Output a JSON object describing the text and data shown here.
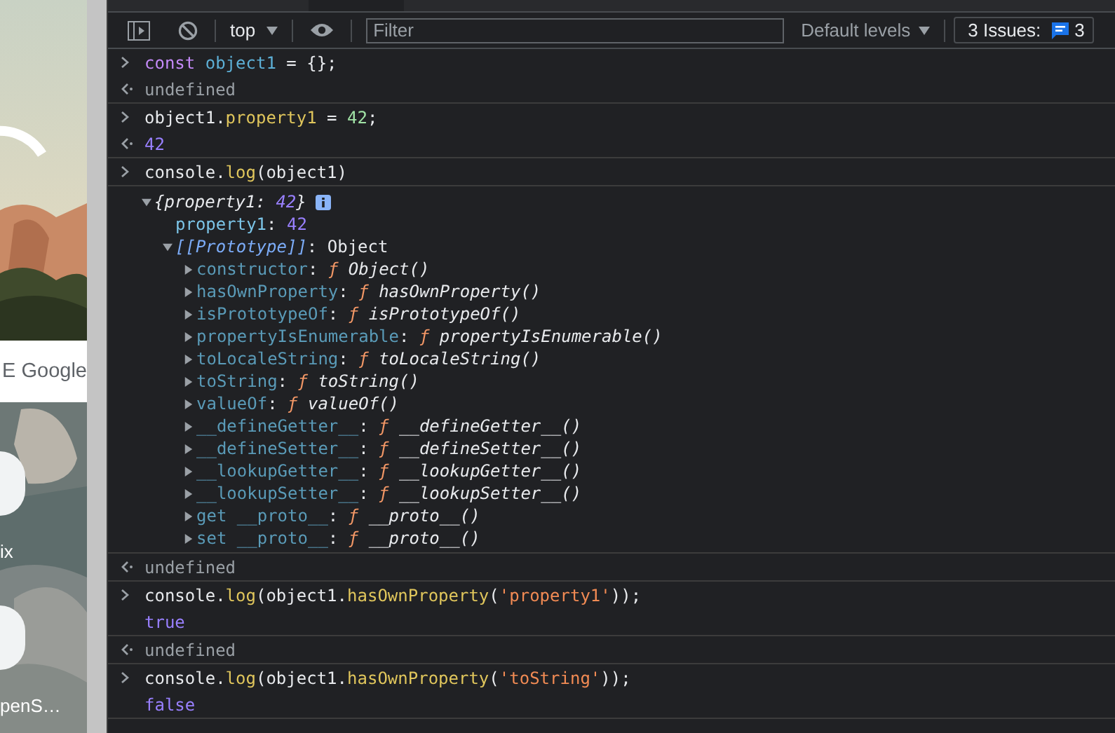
{
  "browser_page": {
    "search_label": "E Google",
    "shortcuts": [
      {
        "label": "ix"
      },
      {
        "label": "penS…"
      }
    ]
  },
  "toolbar": {
    "context": "top",
    "filter": {
      "placeholder": "Filter"
    },
    "levels": "Default levels",
    "issues": {
      "label": "3 Issues:",
      "count": "3"
    }
  },
  "console": [
    {
      "messages": [
        {
          "kind": "input",
          "tokens": [
            {
              "t": "const ",
              "kind": "kw"
            },
            {
              "t": "object1",
              "kind": "var"
            },
            {
              "t": " = {};",
              "kind": "plain"
            }
          ]
        },
        {
          "kind": "result",
          "tokens": [
            {
              "t": "undefined",
              "kind": "dim"
            }
          ]
        }
      ]
    },
    {
      "messages": [
        {
          "kind": "input",
          "tokens": [
            {
              "t": "object1.",
              "kind": "plain"
            },
            {
              "t": "property1",
              "kind": "prop"
            },
            {
              "t": " = ",
              "kind": "plain"
            },
            {
              "t": "42",
              "kind": "num"
            },
            {
              "t": ";",
              "kind": "plain"
            }
          ]
        },
        {
          "kind": "result",
          "tokens": [
            {
              "t": "42",
              "kind": "num2"
            }
          ]
        }
      ]
    },
    {
      "messages": [
        {
          "kind": "input",
          "tokens": [
            {
              "t": "console.",
              "kind": "plain"
            },
            {
              "t": "log",
              "kind": "prop"
            },
            {
              "t": "(object1)",
              "kind": "plain"
            }
          ]
        }
      ]
    },
    {
      "messages": [
        {
          "kind": "tree",
          "node": {
            "expanded": true,
            "info_icon": true,
            "tokens": [
              {
                "t": "{property1: ",
                "kind": "summary"
              },
              {
                "t": "42",
                "kind": "summary-num"
              },
              {
                "t": "}",
                "kind": "summary"
              }
            ],
            "children": [
              {
                "tokens": [
                  {
                    "t": "property1",
                    "kind": "key"
                  },
                  {
                    "t": ": ",
                    "kind": "plain"
                  },
                  {
                    "t": "42",
                    "kind": "num2"
                  }
                ]
              },
              {
                "expanded": true,
                "tokens": [
                  {
                    "t": "[[Prototype]]",
                    "kind": "proto-label"
                  },
                  {
                    "t": ": Object",
                    "kind": "plain"
                  }
                ],
                "children": [
                  {
                    "expanded": false,
                    "tokens": [
                      {
                        "t": "constructor",
                        "kind": "key-proto"
                      },
                      {
                        "t": ": ",
                        "kind": "plain"
                      },
                      {
                        "t": "ƒ ",
                        "kind": "fn-mark"
                      },
                      {
                        "t": "Object()",
                        "kind": "fn-name"
                      }
                    ]
                  },
                  {
                    "expanded": false,
                    "tokens": [
                      {
                        "t": "hasOwnProperty",
                        "kind": "key-proto"
                      },
                      {
                        "t": ": ",
                        "kind": "plain"
                      },
                      {
                        "t": "ƒ ",
                        "kind": "fn-mark"
                      },
                      {
                        "t": "hasOwnProperty()",
                        "kind": "fn-name"
                      }
                    ]
                  },
                  {
                    "expanded": false,
                    "tokens": [
                      {
                        "t": "isPrototypeOf",
                        "kind": "key-proto"
                      },
                      {
                        "t": ": ",
                        "kind": "plain"
                      },
                      {
                        "t": "ƒ ",
                        "kind": "fn-mark"
                      },
                      {
                        "t": "isPrototypeOf()",
                        "kind": "fn-name"
                      }
                    ]
                  },
                  {
                    "expanded": false,
                    "tokens": [
                      {
                        "t": "propertyIsEnumerable",
                        "kind": "key-proto"
                      },
                      {
                        "t": ": ",
                        "kind": "plain"
                      },
                      {
                        "t": "ƒ ",
                        "kind": "fn-mark"
                      },
                      {
                        "t": "propertyIsEnumerable()",
                        "kind": "fn-name"
                      }
                    ]
                  },
                  {
                    "expanded": false,
                    "tokens": [
                      {
                        "t": "toLocaleString",
                        "kind": "key-proto"
                      },
                      {
                        "t": ": ",
                        "kind": "plain"
                      },
                      {
                        "t": "ƒ ",
                        "kind": "fn-mark"
                      },
                      {
                        "t": "toLocaleString()",
                        "kind": "fn-name"
                      }
                    ]
                  },
                  {
                    "expanded": false,
                    "tokens": [
                      {
                        "t": "toString",
                        "kind": "key-proto"
                      },
                      {
                        "t": ": ",
                        "kind": "plain"
                      },
                      {
                        "t": "ƒ ",
                        "kind": "fn-mark"
                      },
                      {
                        "t": "toString()",
                        "kind": "fn-name"
                      }
                    ]
                  },
                  {
                    "expanded": false,
                    "tokens": [
                      {
                        "t": "valueOf",
                        "kind": "key-proto"
                      },
                      {
                        "t": ": ",
                        "kind": "plain"
                      },
                      {
                        "t": "ƒ ",
                        "kind": "fn-mark"
                      },
                      {
                        "t": "valueOf()",
                        "kind": "fn-name"
                      }
                    ]
                  },
                  {
                    "expanded": false,
                    "tokens": [
                      {
                        "t": "__defineGetter__",
                        "kind": "key-proto"
                      },
                      {
                        "t": ": ",
                        "kind": "plain"
                      },
                      {
                        "t": "ƒ ",
                        "kind": "fn-mark"
                      },
                      {
                        "t": "__defineGetter__()",
                        "kind": "fn-name"
                      }
                    ]
                  },
                  {
                    "expanded": false,
                    "tokens": [
                      {
                        "t": "__defineSetter__",
                        "kind": "key-proto"
                      },
                      {
                        "t": ": ",
                        "kind": "plain"
                      },
                      {
                        "t": "ƒ ",
                        "kind": "fn-mark"
                      },
                      {
                        "t": "__defineSetter__()",
                        "kind": "fn-name"
                      }
                    ]
                  },
                  {
                    "expanded": false,
                    "tokens": [
                      {
                        "t": "__lookupGetter__",
                        "kind": "key-proto"
                      },
                      {
                        "t": ": ",
                        "kind": "plain"
                      },
                      {
                        "t": "ƒ ",
                        "kind": "fn-mark"
                      },
                      {
                        "t": "__lookupGetter__()",
                        "kind": "fn-name"
                      }
                    ]
                  },
                  {
                    "expanded": false,
                    "tokens": [
                      {
                        "t": "__lookupSetter__",
                        "kind": "key-proto"
                      },
                      {
                        "t": ": ",
                        "kind": "plain"
                      },
                      {
                        "t": "ƒ ",
                        "kind": "fn-mark"
                      },
                      {
                        "t": "__lookupSetter__()",
                        "kind": "fn-name"
                      }
                    ]
                  },
                  {
                    "expanded": false,
                    "tokens": [
                      {
                        "t": "get __proto__",
                        "kind": "key-proto"
                      },
                      {
                        "t": ": ",
                        "kind": "plain"
                      },
                      {
                        "t": "ƒ ",
                        "kind": "fn-mark"
                      },
                      {
                        "t": "__proto__()",
                        "kind": "fn-name"
                      }
                    ]
                  },
                  {
                    "expanded": false,
                    "tokens": [
                      {
                        "t": "set __proto__",
                        "kind": "key-proto"
                      },
                      {
                        "t": ": ",
                        "kind": "plain"
                      },
                      {
                        "t": "ƒ ",
                        "kind": "fn-mark"
                      },
                      {
                        "t": "__proto__()",
                        "kind": "fn-name"
                      }
                    ]
                  }
                ]
              }
            ]
          }
        }
      ]
    },
    {
      "messages": [
        {
          "kind": "result",
          "tokens": [
            {
              "t": "undefined",
              "kind": "dim"
            }
          ]
        }
      ]
    },
    {
      "messages": [
        {
          "kind": "input",
          "tokens": [
            {
              "t": "console.",
              "kind": "plain"
            },
            {
              "t": "log",
              "kind": "prop"
            },
            {
              "t": "(object1.",
              "kind": "plain"
            },
            {
              "t": "hasOwnProperty",
              "kind": "prop"
            },
            {
              "t": "(",
              "kind": "plain"
            },
            {
              "t": "'property1'",
              "kind": "str"
            },
            {
              "t": "));",
              "kind": "plain"
            }
          ]
        },
        {
          "kind": "log",
          "tokens": [
            {
              "t": "true",
              "kind": "num2"
            }
          ]
        }
      ]
    },
    {
      "messages": [
        {
          "kind": "result",
          "tokens": [
            {
              "t": "undefined",
              "kind": "dim"
            }
          ]
        }
      ]
    },
    {
      "messages": [
        {
          "kind": "input",
          "tokens": [
            {
              "t": "console.",
              "kind": "plain"
            },
            {
              "t": "log",
              "kind": "prop"
            },
            {
              "t": "(object1.",
              "kind": "plain"
            },
            {
              "t": "hasOwnProperty",
              "kind": "prop"
            },
            {
              "t": "(",
              "kind": "plain"
            },
            {
              "t": "'toString'",
              "kind": "str"
            },
            {
              "t": "));",
              "kind": "plain"
            }
          ]
        },
        {
          "kind": "log",
          "tokens": [
            {
              "t": "false",
              "kind": "num2"
            }
          ]
        }
      ]
    }
  ]
}
